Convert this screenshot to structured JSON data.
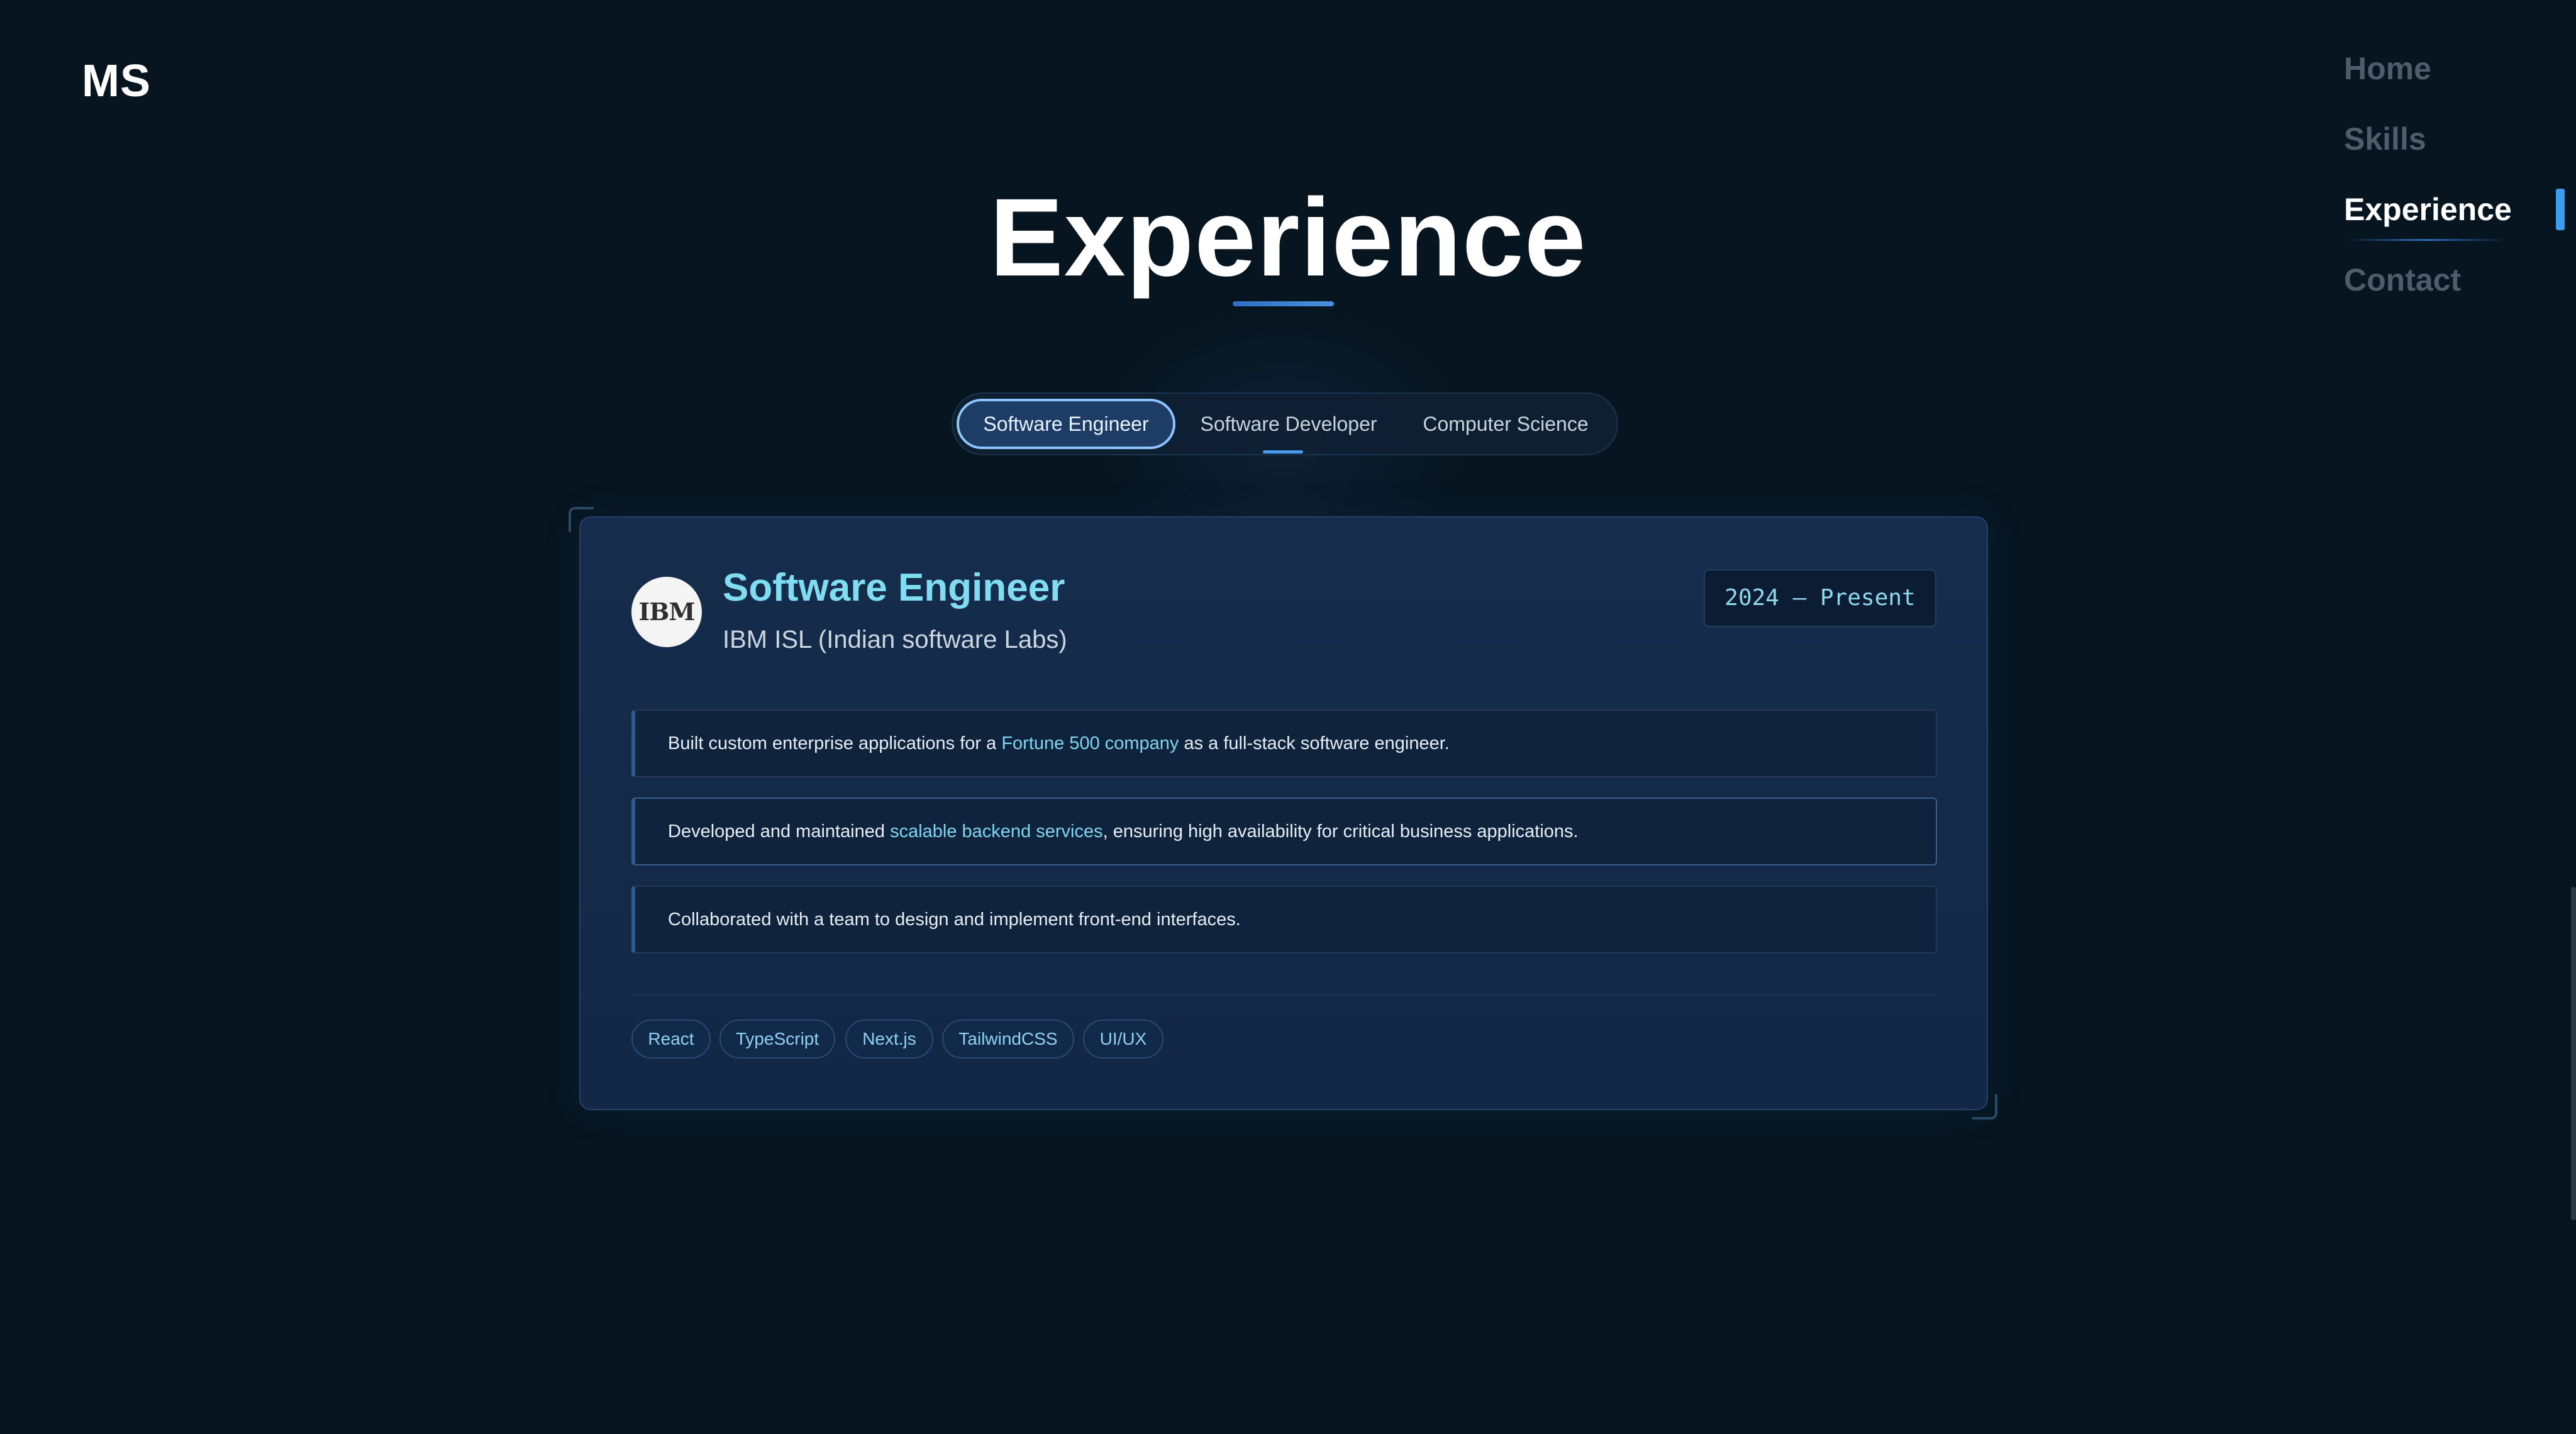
{
  "brand": {
    "logo": "MS"
  },
  "nav": {
    "items": [
      {
        "label": "Home"
      },
      {
        "label": "Skills"
      },
      {
        "label": "Experience"
      },
      {
        "label": "Contact"
      }
    ]
  },
  "section": {
    "title": "Experience"
  },
  "tabs": [
    {
      "label": "Software Engineer"
    },
    {
      "label": "Software Developer"
    },
    {
      "label": "Computer Science"
    }
  ],
  "card": {
    "company_logo": "IBM",
    "role": "Software Engineer",
    "company": "IBM ISL (Indian software Labs)",
    "date": "2024 – Present",
    "bullets": [
      {
        "before": "Built custom enterprise applications for a ",
        "highlight": "Fortune 500 company",
        "after": " as a full-stack software engineer."
      },
      {
        "before": "Developed and maintained ",
        "highlight": "scalable backend services",
        "after": ", ensuring high availability for critical business applications."
      },
      {
        "before": "Collaborated with a team to design and implement front-end interfaces.",
        "highlight": "",
        "after": ""
      }
    ],
    "tags": [
      "React",
      "TypeScript",
      "Next.js",
      "TailwindCSS",
      "UI/UX"
    ]
  },
  "colors": {
    "background": "#071520",
    "accent": "#4a9cf0",
    "highlight_text": "#7fd4f0",
    "card": "#152c4c"
  }
}
